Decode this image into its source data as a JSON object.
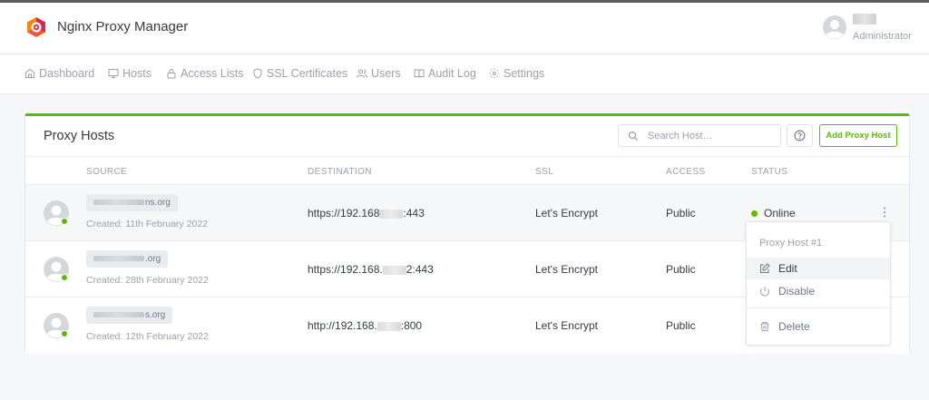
{
  "app": {
    "title": "Nginx Proxy Manager",
    "accent_color": "#5eba00",
    "logo_icon": "nginx-proxy-manager-logo"
  },
  "user": {
    "name": "████",
    "role": "Administrator"
  },
  "nav": {
    "items": [
      {
        "label": "Dashboard",
        "icon": "home-icon"
      },
      {
        "label": "Hosts",
        "icon": "monitor-icon"
      },
      {
        "label": "Access Lists",
        "icon": "lock-icon"
      },
      {
        "label": "SSL Certificates",
        "icon": "shield-icon"
      },
      {
        "label": "Users",
        "icon": "users-icon"
      },
      {
        "label": "Audit Log",
        "icon": "book-icon"
      },
      {
        "label": "Settings",
        "icon": "settings-icon"
      }
    ]
  },
  "card": {
    "title": "Proxy Hosts",
    "search_placeholder": "Search Host…",
    "help_icon": "help-icon",
    "add_button": "Add Proxy Host"
  },
  "table": {
    "columns": [
      "SOURCE",
      "DESTINATION",
      "SSL",
      "ACCESS",
      "STATUS"
    ],
    "rows": [
      {
        "domain_suffix": "ns.org",
        "created": "Created: 11th February 2022",
        "dest_prefix": "https://192.168",
        "dest_suffix": ":443",
        "ssl": "Let's Encrypt",
        "access": "Public",
        "status": "Online"
      },
      {
        "domain_suffix": ".org",
        "created": "Created: 28th February 2022",
        "dest_prefix": "https://192.168.",
        "dest_suffix": "2:443",
        "ssl": "Let's Encrypt",
        "access": "Public",
        "status": ""
      },
      {
        "domain_suffix": "s.org",
        "created": "Created: 12th February 2022",
        "dest_prefix": "http://192.168.",
        "dest_suffix": ":800",
        "ssl": "Let's Encrypt",
        "access": "Public",
        "status": ""
      }
    ]
  },
  "dropdown": {
    "header": "Proxy Host #1",
    "items": [
      {
        "label": "Edit",
        "icon": "edit-icon"
      },
      {
        "label": "Disable",
        "icon": "power-icon"
      },
      {
        "label": "Delete",
        "icon": "trash-icon"
      }
    ]
  }
}
